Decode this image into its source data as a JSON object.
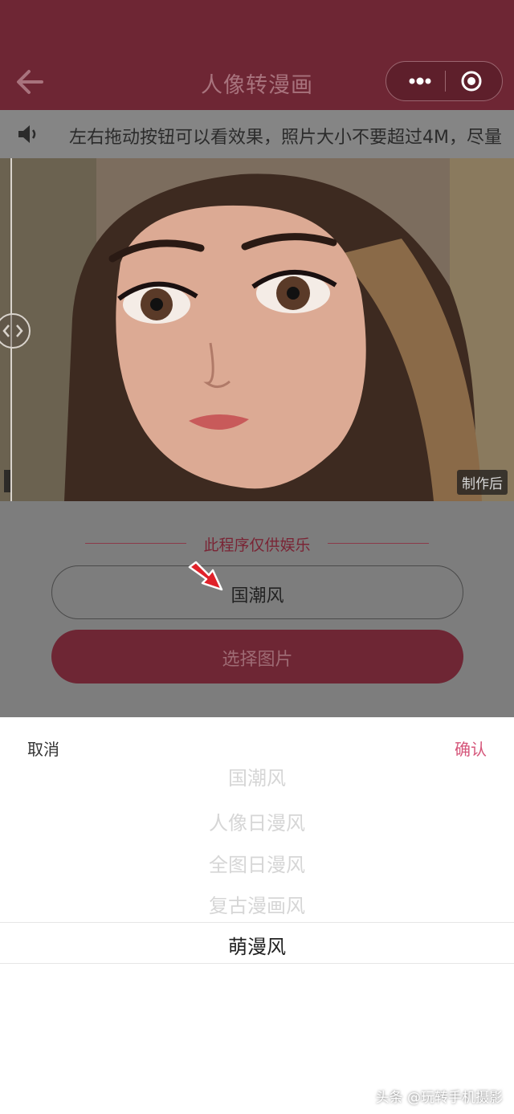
{
  "header": {
    "title": "人像转漫画",
    "back_icon": "back-arrow-icon",
    "more_icon": "more-dots-icon",
    "close_icon": "miniprogram-close-icon"
  },
  "notice": {
    "icon": "speaker-icon",
    "text": "左右拖动按钮可以看效果，照片大小不要超过4M，尽量"
  },
  "preview": {
    "after_label": "制作后",
    "drag_icon": "drag-handle-icon"
  },
  "main": {
    "disclaimer": "此程序仅供娱乐",
    "style_value": "国潮风",
    "pick_button": "选择图片",
    "arrow_icon": "red-arrow-icon"
  },
  "picker": {
    "cancel": "取消",
    "confirm": "确认",
    "options": [
      "国潮风",
      "人像日漫风",
      "全图日漫风",
      "复古漫画风",
      "萌漫风"
    ],
    "selected": "萌漫风"
  },
  "watermark": "头条 @玩转手机摄影",
  "colors": {
    "header_bg": "#6e2634",
    "accent": "#d5567a",
    "disclaimer": "#7a2535"
  }
}
